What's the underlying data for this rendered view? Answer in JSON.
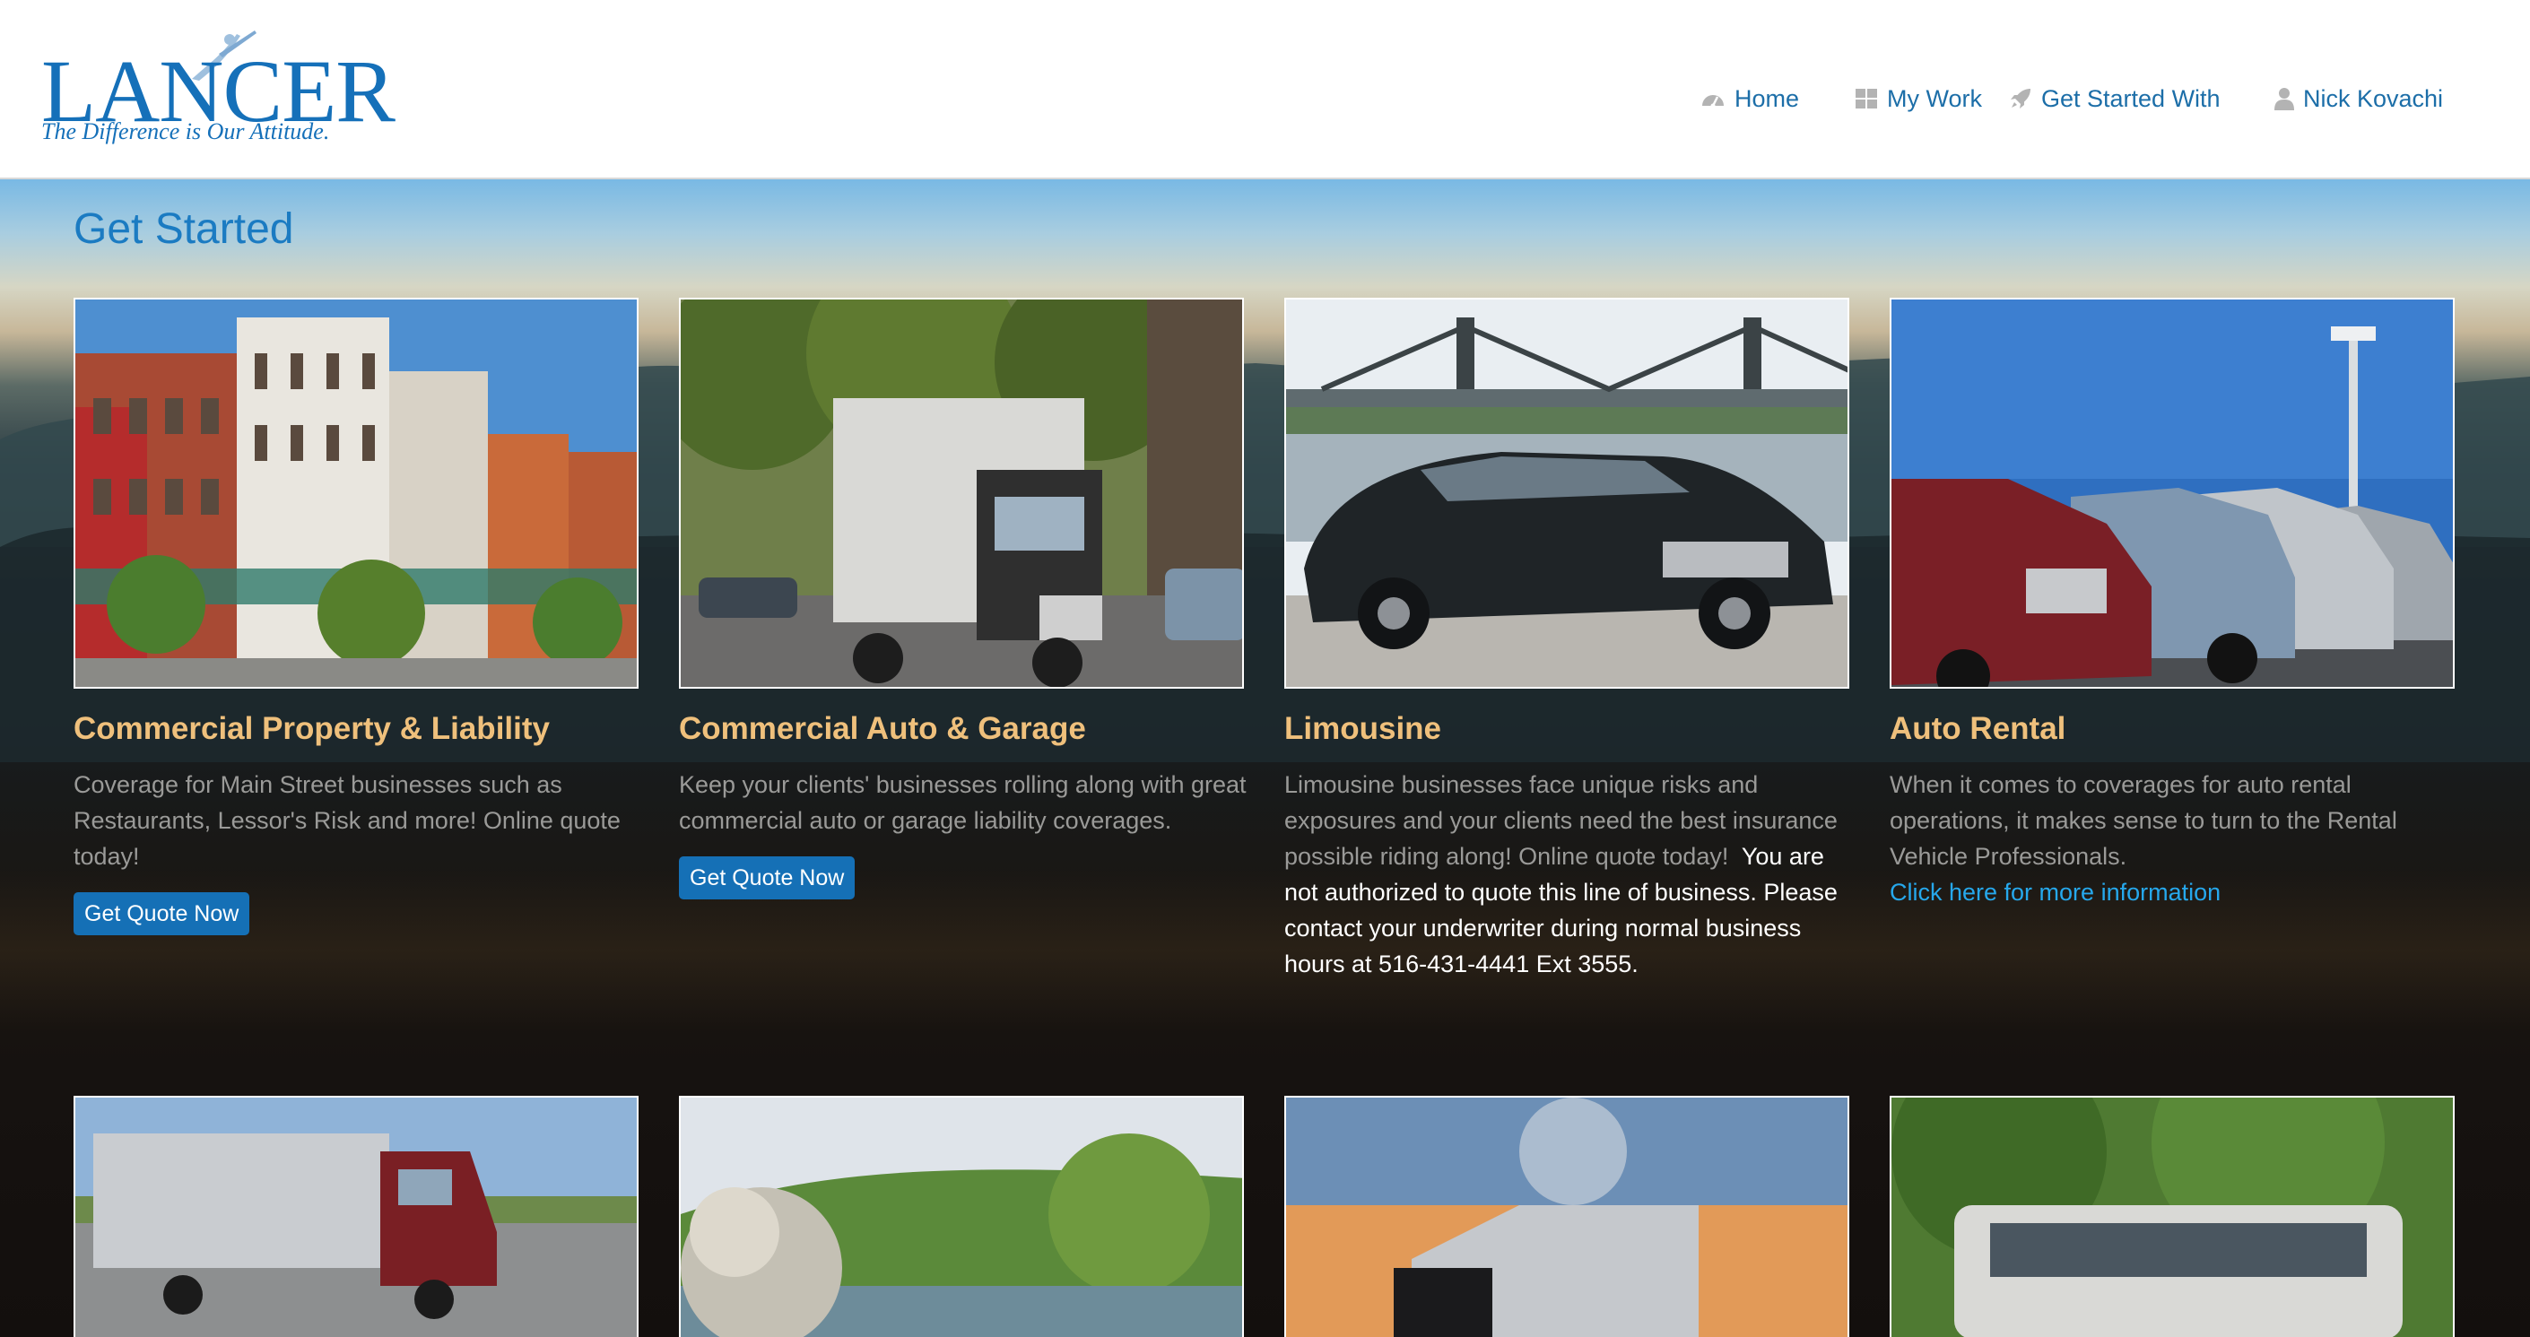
{
  "brand": {
    "name": "LANCER",
    "tagline": "The Difference is Our Attitude.",
    "color": "#1570b9"
  },
  "nav": {
    "items": [
      {
        "label": "Home",
        "icon": "dashboard-icon"
      },
      {
        "label": "My Work",
        "icon": "grid-icon"
      },
      {
        "label": "Get Started With",
        "icon": "rocket-icon"
      },
      {
        "label": "Nick Kovachi",
        "icon": "user-icon"
      }
    ]
  },
  "page": {
    "title": "Get Started"
  },
  "cards": [
    {
      "title": "Commercial Property & Liability",
      "description": "Coverage for Main Street businesses such as Restaurants, Lessor's Risk and more! Online quote today!",
      "button": "Get Quote Now",
      "image": "main-street-storefronts"
    },
    {
      "title": "Commercial Auto & Garage",
      "description": "Keep your clients' businesses rolling along with great commercial auto or garage liability coverages.",
      "button": "Get Quote Now",
      "image": "box-truck-on-street"
    },
    {
      "title": "Limousine",
      "description": "Limousine businesses face unique risks and exposures and your clients need the best insurance possible riding along! Online quote today!",
      "warning": "You are not authorized to quote this line of business. Please contact your underwriter during normal business hours at 516-431-4441 Ext 3555.",
      "image": "black-sedan-by-bridge"
    },
    {
      "title": "Auto Rental",
      "description": "When it comes to coverages for auto rental operations, it makes sense to turn to the Rental Vehicle Professionals.",
      "link": "Click here for more information",
      "image": "row-of-rental-cars"
    }
  ],
  "second_row_images": [
    "semi-truck-lot",
    "water-splash-lake",
    "truck-at-sunset",
    "bus-under-trees"
  ],
  "colors": {
    "title_blue": "#1b7bc2",
    "card_title": "#efc07c",
    "description": "#9a9a98",
    "button": "#1570b6",
    "link": "#26a8ec"
  }
}
